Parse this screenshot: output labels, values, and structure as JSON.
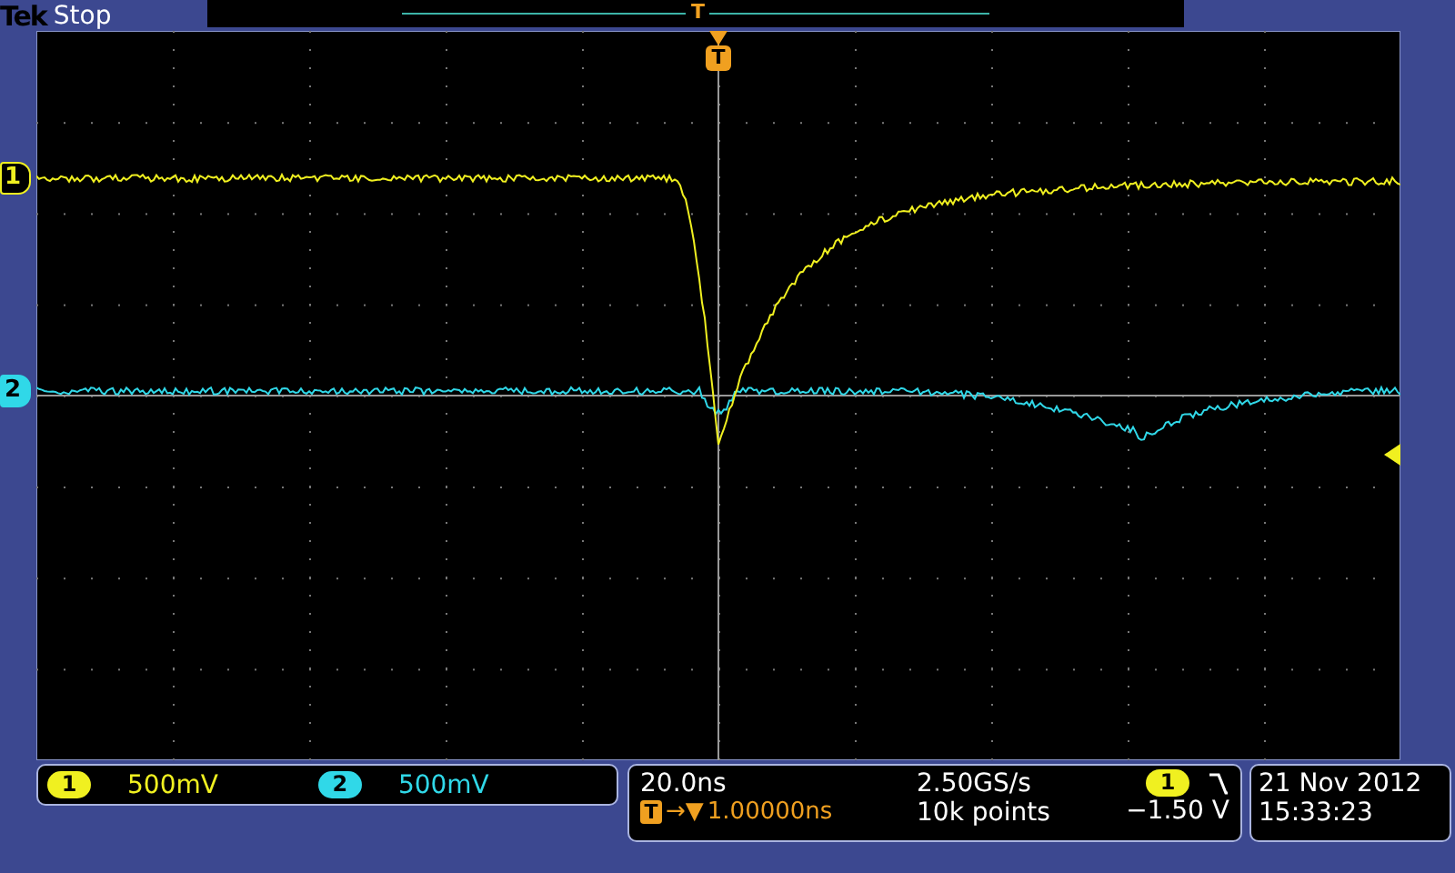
{
  "brand": "Tek",
  "status": "Stop",
  "record_trigger_marker": "T",
  "trigger_position_marker": "T",
  "channels": [
    {
      "marker": "1",
      "badge": "1",
      "scale": "500mV",
      "color": "#f0f020"
    },
    {
      "marker": "2",
      "badge": "2",
      "scale": "500mV",
      "color": "#30d8e8"
    }
  ],
  "timebase": {
    "scale": "20.0ns",
    "trigger_badge": "T",
    "position_arrow": "→▼",
    "position": "1.00000ns",
    "sample_rate": "2.50GS/s",
    "record_length": "10k points"
  },
  "trigger": {
    "source": "1",
    "reading": "−1.50 V"
  },
  "datetime": {
    "date": "21 Nov 2012",
    "time": "15:33:23"
  }
}
